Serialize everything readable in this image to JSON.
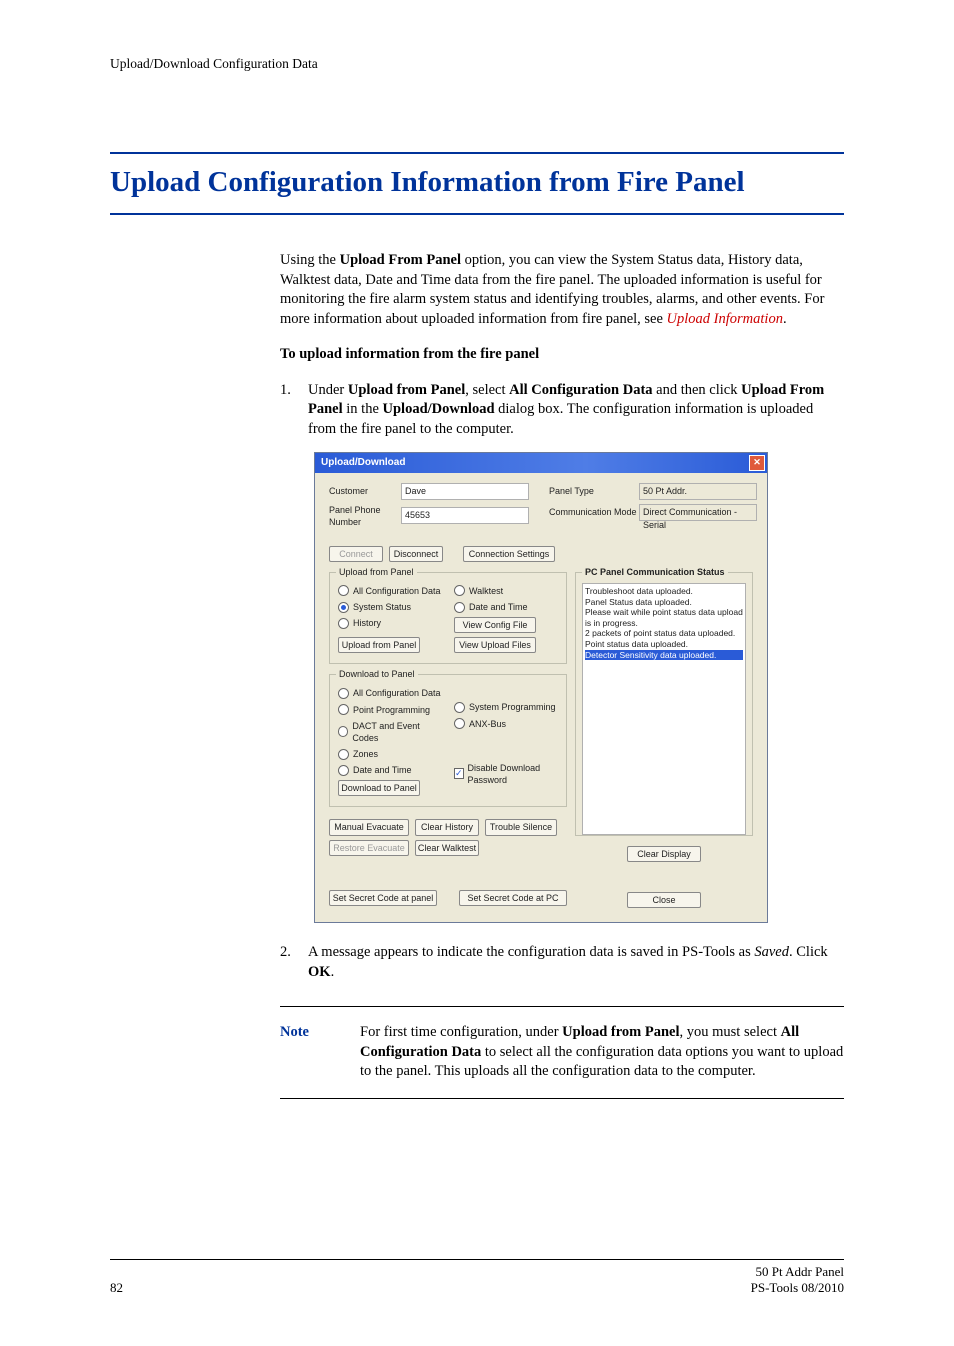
{
  "header": {
    "running": "Upload/Download Configuration Data"
  },
  "title": "Upload Configuration Information from Fire Panel",
  "intro": {
    "p1a": "Using the ",
    "p1b": "Upload From Panel",
    "p1c": " option, you can view the System Status data, History data, Walktest data, Date and Time data from the fire panel. The uploaded information is useful for monitoring the fire alarm system status and identifying troubles, alarms, and other events. For more information about uploaded information from fire panel, see ",
    "link": "Upload Information",
    "p1d": "."
  },
  "subhead": "To upload information from the fire panel",
  "steps": {
    "s1": {
      "num": "1.",
      "a": "Under ",
      "b": "Upload from Panel",
      "c": ", select ",
      "d": "All Configuration Data",
      "e": " and then click ",
      "f": "Upload From Panel",
      "g": " in the ",
      "h": "Upload/Download",
      "i": " dialog box. The configuration information is uploaded from the fire panel to the computer."
    },
    "s2": {
      "num": "2.",
      "a": "A message appears to indicate the configuration data is saved in PS-Tools as ",
      "b": "Saved",
      "c": ". Click ",
      "d": "OK",
      "e": "."
    }
  },
  "dialog": {
    "title": "Upload/Download",
    "customer_lbl": "Customer",
    "customer_val": "Dave",
    "phone_lbl": "Panel Phone Number",
    "phone_val": "45653",
    "ptype_lbl": "Panel Type",
    "ptype_val": "50 Pt Addr.",
    "cmode_lbl": "Communication Mode",
    "cmode_val": "Direct Communication - Serial",
    "btn_connect": "Connect",
    "btn_disconnect": "Disconnect",
    "btn_connset": "Connection Settings",
    "grp_upload": "Upload from Panel",
    "r_allcfg": "All Configuration Data",
    "r_sysstat": "System Status",
    "r_history": "History",
    "r_walktest": "Walktest",
    "r_datetime": "Date and Time",
    "btn_viewcfg": "View Config File",
    "btn_upload_from_panel": "Upload from Panel",
    "btn_view_upload": "View Upload Files",
    "status_title": "PC Panel Communication Status",
    "status_lines": [
      "Troubleshoot data uploaded.",
      "Panel Status data uploaded.",
      "Please wait while point status data upload is in progress.",
      "2 packets of point status data uploaded.",
      "Point status data uploaded."
    ],
    "status_hl": "Detector Sensitivity data uploaded.",
    "grp_download": "Download to Panel",
    "d_allcfg": "All Configuration Data",
    "d_pointprog": "Point Programming",
    "d_dact": "DACT and Event Codes",
    "d_zones": "Zones",
    "d_datetime": "Date and Time",
    "d_sysprog": "System Programming",
    "d_anxbus": "ANX-Bus",
    "btn_download": "Download to Panel",
    "chk_disable": "Disable Download Password",
    "btn_manual_evac": "Manual Evacuate",
    "btn_restore_evac": "Restore Evacuate",
    "btn_clear_hist": "Clear History",
    "btn_clear_walk": "Clear Walktest",
    "btn_trouble_silence": "Trouble Silence",
    "btn_secret_panel": "Set Secret Code at panel",
    "btn_secret_pc": "Set Secret Code at PC",
    "btn_clear_display": "Clear Display",
    "btn_close": "Close"
  },
  "note": {
    "label": "Note",
    "a": "For first time configuration, under ",
    "b": "Upload from Panel",
    "c": ", you must select ",
    "d": "All Configuration Data",
    "e": " to select all the configuration data options you want to upload to the panel. This uploads all the configuration data to the computer."
  },
  "footer": {
    "page": "82",
    "right1": "50 Pt Addr Panel",
    "right2": "PS-Tools 08/2010"
  }
}
